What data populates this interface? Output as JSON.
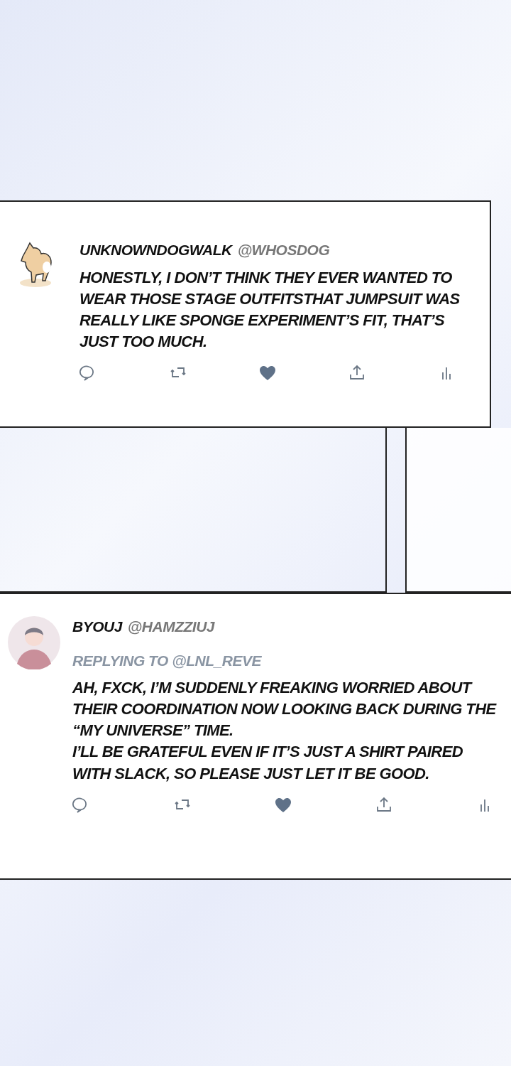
{
  "tweets": [
    {
      "avatar": {
        "kind": "dog"
      },
      "display_name": "UNKNOWNDOGWALK",
      "handle": "@WHOSDOG",
      "paragraphs": [
        "HONESTLY, I DON’T THINK THEY EVER WANTED TO WEAR THOSE STAGE OUTFITSTHAT JUMPSUIT WAS REALLY LIKE SPONGE EXPERIMENT’S FIT, THAT’S JUST TOO MUCH."
      ],
      "liked": true
    },
    {
      "avatar": {
        "kind": "person"
      },
      "display_name": "BYOUJ",
      "handle": "@HAMZZIUJ",
      "reply_to": "REPLYING TO @LNL_REVE",
      "paragraphs": [
        "AH, FXCK, I’M SUDDENLY FREAKING WORRIED ABOUT THEIR COORDINATION NOW LOOKING BACK DURING THE “MY UNIVERSE” TIME.",
        "I’LL BE GRATEFUL EVEN IF IT’S JUST A SHIRT PAIRED WITH SLACK, SO PLEASE JUST LET IT BE GOOD."
      ],
      "liked": true
    }
  ]
}
